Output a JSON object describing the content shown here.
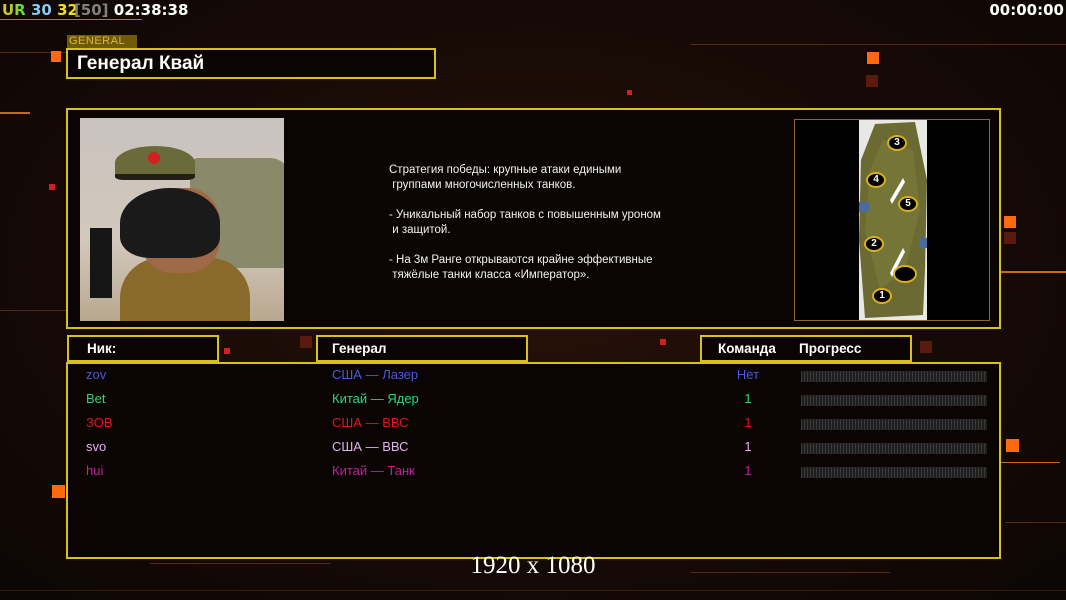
{
  "hud": {
    "label": "UR",
    "fps": "30",
    "value1": "32",
    "bracket": "[50]",
    "clock": "02:38:38",
    "timer": "00:00:00"
  },
  "general": {
    "tag": "GENERAL",
    "name": "Генерал Квай",
    "description": "Стратегия победы: крупные атаки едиными\n группами многочисленных танков.\n\n- Уникальный набор танков с повышенным уроном\n и защитой.\n\n- На 3м Ранге открываются крайне эффективные\n тяжёлые танки класса «Император».",
    "map_positions": [
      "1",
      "2",
      "3",
      "4",
      "5"
    ]
  },
  "table": {
    "headers": {
      "nick": "Ник:",
      "general": "Генерал",
      "team": "Команда",
      "progress": "Прогресс"
    },
    "rows": [
      {
        "nick": "zov",
        "general": "США — Лазер",
        "team": "Нет",
        "progress": 0,
        "color": "#4a5ad8"
      },
      {
        "nick": "Bet",
        "general": "Китай — Ядер",
        "team": "1",
        "progress": 0,
        "color": "#2ad87a"
      },
      {
        "nick": "ЗОВ",
        "general": "США — ВВС",
        "team": "1",
        "progress": 0,
        "color": "#e01818"
      },
      {
        "nick": "svo",
        "general": "США — ВВС",
        "team": "1",
        "progress": 0,
        "color": "#e0b0f0"
      },
      {
        "nick": "hui",
        "general": "Китай — Танк",
        "team": "1",
        "progress": 0,
        "color": "#c020a0"
      }
    ]
  },
  "resolution": "1920 x 1080"
}
